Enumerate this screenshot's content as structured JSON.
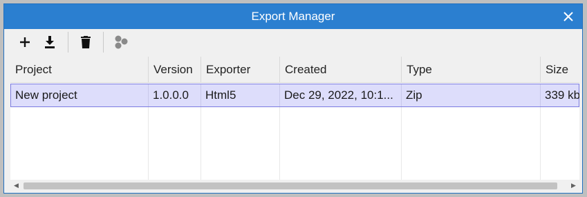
{
  "window": {
    "title": "Export Manager"
  },
  "toolbar": {
    "buttons": [
      {
        "icon": "plus-icon"
      },
      {
        "icon": "download-icon"
      },
      {
        "icon": "trash-icon"
      },
      {
        "icon": "cluster-icon"
      }
    ]
  },
  "table": {
    "columns": [
      "Project",
      "Version",
      "Exporter",
      "Created",
      "Type",
      "Size"
    ],
    "rows": [
      [
        "New project",
        "1.0.0.0",
        "Html5",
        "Dec 29, 2022, 10:1...",
        "Zip",
        "339 kb"
      ]
    ]
  },
  "colors": {
    "titlebar": "#2b7fd0",
    "selected_row": "#ddddfb",
    "selected_border": "#7b7be0"
  }
}
